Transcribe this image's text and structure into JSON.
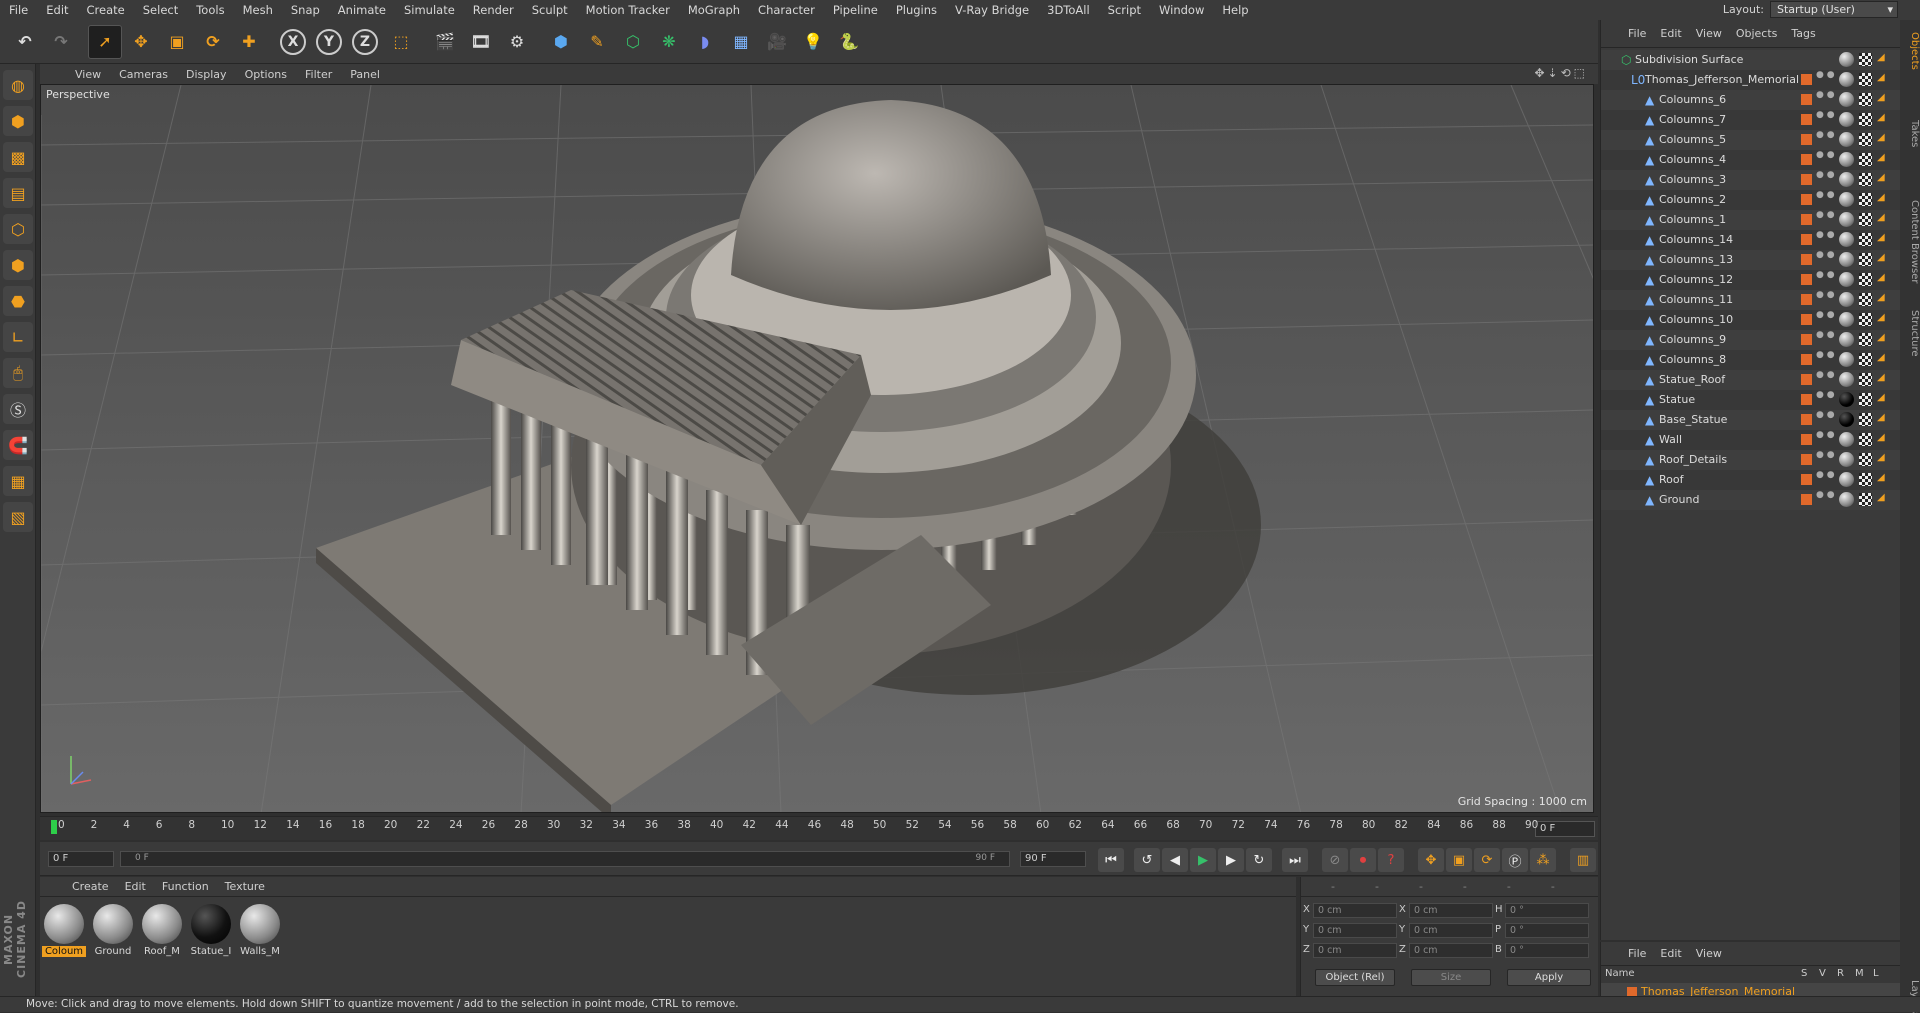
{
  "menu": [
    "File",
    "Edit",
    "Create",
    "Select",
    "Tools",
    "Mesh",
    "Snap",
    "Animate",
    "Simulate",
    "Render",
    "Sculpt",
    "Motion Tracker",
    "MoGraph",
    "Character",
    "Pipeline",
    "Plugins",
    "V-Ray Bridge",
    "3DToAll",
    "Script",
    "Window",
    "Help"
  ],
  "layout": {
    "label": "Layout:",
    "value": "Startup (User)"
  },
  "viewport": {
    "menu": [
      "View",
      "Cameras",
      "Display",
      "Options",
      "Filter",
      "Panel"
    ],
    "label": "Perspective",
    "grid_spacing": "Grid Spacing : 1000 cm"
  },
  "timeline": {
    "ticks": [
      "0",
      "2",
      "4",
      "6",
      "8",
      "10",
      "12",
      "14",
      "16",
      "18",
      "20",
      "22",
      "24",
      "26",
      "28",
      "30",
      "32",
      "34",
      "36",
      "38",
      "40",
      "42",
      "44",
      "46",
      "48",
      "50",
      "52",
      "54",
      "56",
      "58",
      "60",
      "62",
      "64",
      "66",
      "68",
      "70",
      "72",
      "74",
      "76",
      "78",
      "80",
      "82",
      "84",
      "86",
      "88",
      "90"
    ],
    "current": "0 F"
  },
  "transport": {
    "start": "0 F",
    "slider_start": "0 F",
    "slider_end": "90 F",
    "end": "90 F"
  },
  "materials": {
    "menu": [
      "Create",
      "Edit",
      "Function",
      "Texture"
    ],
    "items": [
      {
        "label": "Coloum",
        "dark": false,
        "selected": true
      },
      {
        "label": "Ground",
        "dark": false,
        "selected": false
      },
      {
        "label": "Roof_M",
        "dark": false,
        "selected": false
      },
      {
        "label": "Statue_I",
        "dark": true,
        "selected": false
      },
      {
        "label": "Walls_M",
        "dark": false,
        "selected": false
      }
    ]
  },
  "coords": {
    "header": [
      "--",
      "--",
      "--"
    ],
    "rows": [
      {
        "a": "X",
        "av": "0 cm",
        "b": "X",
        "bv": "0 cm",
        "c": "H",
        "cv": "0 °"
      },
      {
        "a": "Y",
        "av": "0 cm",
        "b": "Y",
        "bv": "0 cm",
        "c": "P",
        "cv": "0 °"
      },
      {
        "a": "Z",
        "av": "0 cm",
        "b": "Z",
        "bv": "0 cm",
        "c": "B",
        "cv": "0 °"
      }
    ],
    "mode": "Object (Rel)",
    "size": "Size",
    "apply": "Apply"
  },
  "objects": {
    "menu": [
      "File",
      "Edit",
      "View",
      "Objects",
      "Tags"
    ],
    "root": "Subdivision Surface",
    "group": "Thomas_Jefferson_Memorial",
    "items": [
      "Coloumns_6",
      "Coloumns_7",
      "Coloumns_5",
      "Coloumns_4",
      "Coloumns_3",
      "Coloumns_2",
      "Coloumns_1",
      "Coloumns_14",
      "Coloumns_13",
      "Coloumns_12",
      "Coloumns_11",
      "Coloumns_10",
      "Coloumns_9",
      "Coloumns_8",
      "Statue_Roof",
      "Statue",
      "Base_Statue",
      "Wall",
      "Roof_Details",
      "Roof",
      "Ground"
    ]
  },
  "side_tabs": [
    "Objects",
    "Takes",
    "Content Browser",
    "Structure",
    "Layers"
  ],
  "layers": {
    "menu": [
      "File",
      "Edit",
      "View"
    ],
    "cols": [
      "Name",
      "S",
      "V",
      "R",
      "M",
      "L"
    ],
    "layer": "Thomas_Jefferson_Memorial"
  },
  "status": "Move: Click and drag to move elements. Hold down SHIFT to quantize movement / add to the selection in point mode, CTRL to remove."
}
